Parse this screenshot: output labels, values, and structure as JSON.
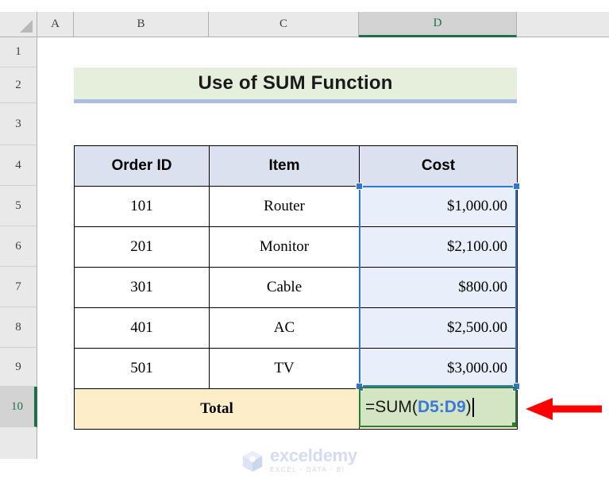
{
  "app": {
    "type": "spreadsheet"
  },
  "columns": {
    "headers": [
      {
        "label": "A",
        "selected": false
      },
      {
        "label": "B",
        "selected": false
      },
      {
        "label": "C",
        "selected": false
      },
      {
        "label": "D",
        "selected": true
      }
    ]
  },
  "rows": {
    "headers": [
      {
        "label": "1",
        "selected": false
      },
      {
        "label": "2",
        "selected": false
      },
      {
        "label": "3",
        "selected": false
      },
      {
        "label": "4",
        "selected": false
      },
      {
        "label": "5",
        "selected": false
      },
      {
        "label": "6",
        "selected": false
      },
      {
        "label": "7",
        "selected": false
      },
      {
        "label": "8",
        "selected": false
      },
      {
        "label": "9",
        "selected": false
      },
      {
        "label": "10",
        "selected": true
      }
    ]
  },
  "title_banner": {
    "text": "Use of SUM Function",
    "background": "#e6efdc",
    "accent": "#a9bde2"
  },
  "table": {
    "headers": [
      "Order ID",
      "Item",
      "Cost"
    ],
    "header_background": "#dce1f0",
    "rows": [
      {
        "order_id": "101",
        "item": "Router",
        "cost": "$1,000.00"
      },
      {
        "order_id": "201",
        "item": "Monitor",
        "cost": "$2,100.00"
      },
      {
        "order_id": "301",
        "item": "Cable",
        "cost": "$800.00"
      },
      {
        "order_id": "401",
        "item": "AC",
        "cost": "$2,500.00"
      },
      {
        "order_id": "501",
        "item": "TV",
        "cost": "$3,000.00"
      }
    ],
    "total_label": "Total",
    "total_background": "#fdeec9",
    "selected_cost_background": "#e9effa"
  },
  "formula_cell": {
    "prefix": "=SUM(",
    "reference": "D5:D9",
    "suffix": ")",
    "reference_color": "#3c78d8",
    "cell_background": "#d4e5c4",
    "border_color": "#2e7d32"
  },
  "selection": {
    "range": "D5:D9",
    "border_color": "#2e75d4"
  },
  "annotation": {
    "arrow_color": "#ff0000",
    "arrow_direction": "left"
  },
  "watermark": {
    "name": "exceldemy",
    "tagline": "EXCEL - DATA - BI"
  }
}
